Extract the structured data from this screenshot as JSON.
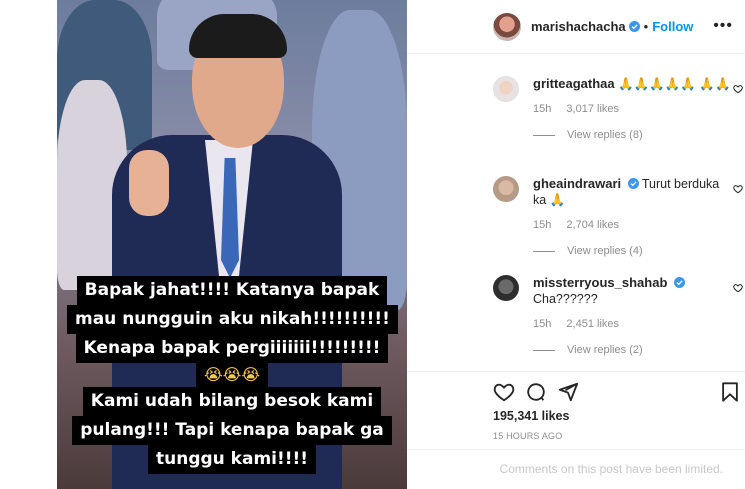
{
  "post": {
    "username": "marishachacha",
    "follow_label": "Follow",
    "dot": "•",
    "more_label": "•••",
    "caption_lines": [
      "Bapak jahat!!!! Katanya bapak",
      "mau nungguin aku nikah!!!!!!!!!!",
      "Kenapa bapak pergiiiiiii!!!!!!!!!",
      "😭😭😭",
      "Kami udah bilang besok kami",
      "pulang!!! Tapi kenapa bapak ga",
      "tunggu kami!!!!"
    ]
  },
  "comments": [
    {
      "username": "gritteagathaa",
      "text": "🙏🙏🙏🙏🙏 🙏🙏",
      "time": "15h",
      "likes": "3,017 likes",
      "replies": "View replies (8)"
    },
    {
      "username": "gheaindrawari",
      "text": "Turut berduka ka 🙏",
      "time": "15h",
      "likes": "2,704 likes",
      "replies": "View replies (4)"
    },
    {
      "username": "missterryous_shahab",
      "text": "Cha??????",
      "time": "15h",
      "likes": "2,451 likes",
      "replies": "View replies (2)"
    }
  ],
  "footer": {
    "likes": "195,341 likes",
    "time": "15 HOURS AGO",
    "comments_limited": "Comments on this post have been limited."
  },
  "icons": {
    "heart": "heart-icon",
    "comment": "comment-icon",
    "share": "share-icon",
    "save": "bookmark-icon",
    "verified": "verified-badge-icon"
  },
  "colors": {
    "accent": "#0095f6",
    "muted": "#8e8e8e",
    "text": "#262626"
  }
}
